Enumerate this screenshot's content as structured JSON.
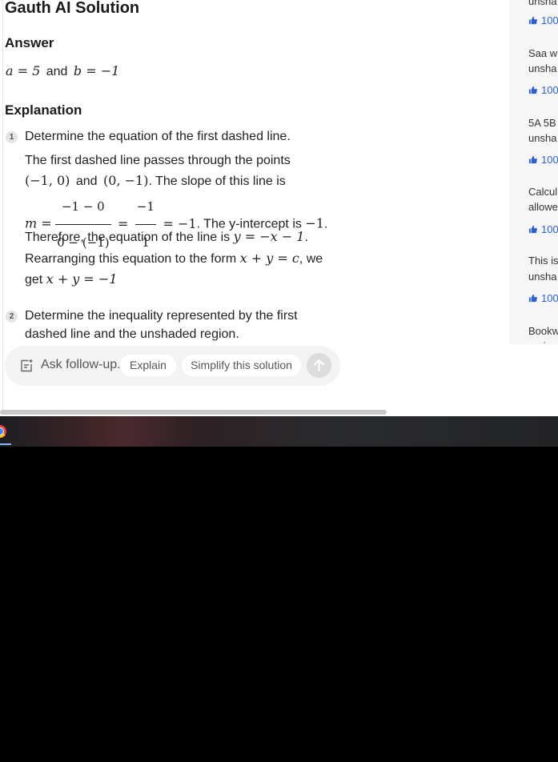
{
  "header": {
    "title": "Gauth AI Solution"
  },
  "answer": {
    "heading": "Answer",
    "a_expr": "a = 5",
    "and": "and",
    "b_expr": "b = −1"
  },
  "explanation": {
    "heading": "Explanation",
    "steps": [
      {
        "number": "1",
        "title": "Determine the equation of the first dashed line.",
        "l1": "The first dashed line passes through the points",
        "l2_p1": "(−1, 0)",
        "l2_and": "and",
        "l2_p2": "(0, −1)",
        "l2_tail": ". The slope of this line is",
        "l3_m": "m =",
        "l3_num1": "−1 − 0",
        "l3_den1": "0 − (−1)",
        "l3_eq": "=",
        "l3_num2": "−1",
        "l3_den2": "1",
        "l3_res": "= −1",
        "l3_tail": ". The y-intercept is",
        "l3_int": "−1",
        "l3_dot": ".",
        "l4_text": "Therefore, the equation of the line is",
        "l4_eq": "y = −x − 1",
        "l4_dot": ".",
        "l5_text": "Rearranging this equation to the form",
        "l5_eq": "x + y = c",
        "l5_tail": ", we",
        "l6_text": "get",
        "l6_eq": "x + y = −1"
      },
      {
        "number": "2",
        "title_l1": "Determine the inequality represented by the first",
        "title_l2": "dashed line and the unshaded region."
      }
    ]
  },
  "sidebar": {
    "items": [
      {
        "lines": [
          "unsha"
        ],
        "likes": "100"
      },
      {
        "lines": [
          "Saa w",
          "unsha"
        ],
        "likes": "100"
      },
      {
        "lines": [
          "5A 5B",
          "unsha"
        ],
        "likes": "100"
      },
      {
        "lines": [
          "Calcul",
          "allowe"
        ],
        "likes": "100"
      },
      {
        "lines": [
          "This is",
          "unsha"
        ],
        "likes": "100"
      },
      {
        "lines": [
          "Bookw",
          "region"
        ]
      }
    ]
  },
  "chat": {
    "placeholder": "Ask follow-up...",
    "chips": [
      "Explain",
      "Simplify this solution"
    ]
  },
  "colors": {
    "accent_blue": "#2a5fd8",
    "chat_bg": "#f3f3f3"
  },
  "icons": [
    "follow-up-icon",
    "send-arrow-icon",
    "thumbs-up-icon",
    "chrome-icon"
  ]
}
